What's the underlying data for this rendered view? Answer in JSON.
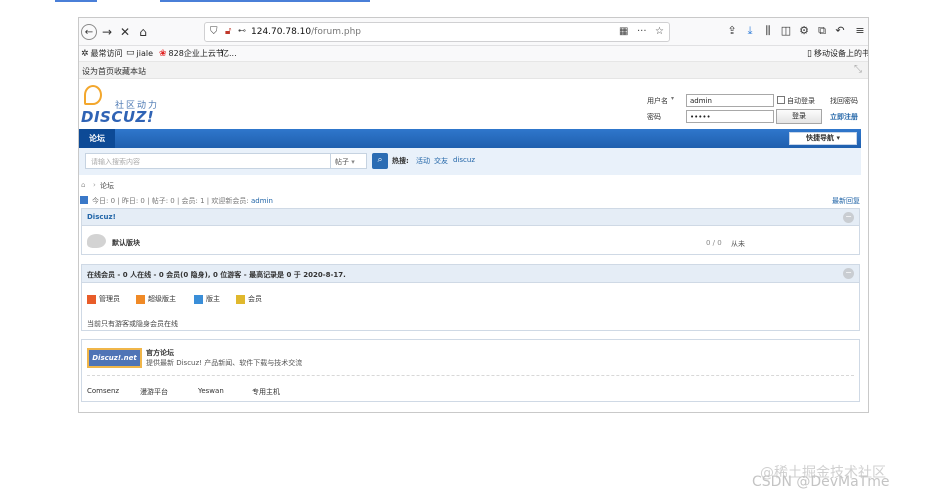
{
  "browser": {
    "url_host": "124.70.78.10",
    "url_path": "/forum.php",
    "url_prefix_icon": "shield-icon",
    "bookmarks": [
      {
        "icon": "gear-icon",
        "label": "最常访问"
      },
      {
        "icon": "folder-icon",
        "label": "jiale"
      },
      {
        "icon": "huawei-icon",
        "label": "828企业上云节"
      },
      {
        "icon": "bookmark-icon",
        "label": "亿..."
      }
    ],
    "mobile_bookmarks": "移动设备上的书签"
  },
  "toolbar": {
    "set_home": "设为首页",
    "bookmark_site": "收藏本站"
  },
  "header": {
    "logo_cn": "社区动力",
    "logo_en": "DISCUZ!",
    "login": {
      "username_label": "用户名",
      "username_value": "admin",
      "password_label": "密码",
      "password_value": "•••••",
      "auto_login": "自动登录",
      "find_password": "找回密码",
      "login_button": "登录",
      "register": "立即注册"
    }
  },
  "nav": {
    "tab_forum": "论坛",
    "quick_nav": "快捷导航"
  },
  "search": {
    "placeholder": "请输入搜索内容",
    "type": "帖子",
    "hot_label": "热搜:",
    "hot_links": [
      "活动",
      "交友",
      "discuz"
    ]
  },
  "breadcrumb": {
    "current": "论坛"
  },
  "stats": {
    "text": "今日: 0 | 昨日: 0 | 帖子: 0 | 会员: 1 | 欢迎新会员: ",
    "new_member": "admin",
    "latest_reply": "最新回复"
  },
  "forums": {
    "category": "Discuz!",
    "items": [
      {
        "name": "默认版块",
        "count": "0 / 0",
        "last": "从未"
      }
    ]
  },
  "online": {
    "title": "在线会员 - 0 人在线 - 0 会员(0 隐身), 0 位游客 - 最高记录是 0 于 2020-8-17.",
    "legend": [
      {
        "label": "管理员",
        "color": "#e85c29"
      },
      {
        "label": "超级版主",
        "color": "#f08a26"
      },
      {
        "label": "版主",
        "color": "#3a8ed8"
      },
      {
        "label": "会员",
        "color": "#e0b82d"
      }
    ],
    "empty": "当前只有游客或隐身会员在线"
  },
  "links": {
    "logo_text": "Discuz!.net",
    "name": "官方论坛",
    "desc": "提供最新 Discuz! 产品新闻、软件下载与技术交流",
    "text_links": [
      "Comsenz",
      "漫游平台",
      "Yeswan",
      "专用主机"
    ]
  },
  "watermark": {
    "line1": "@稀土掘金技术社区",
    "line2": "CSDN @DevMaTme"
  }
}
